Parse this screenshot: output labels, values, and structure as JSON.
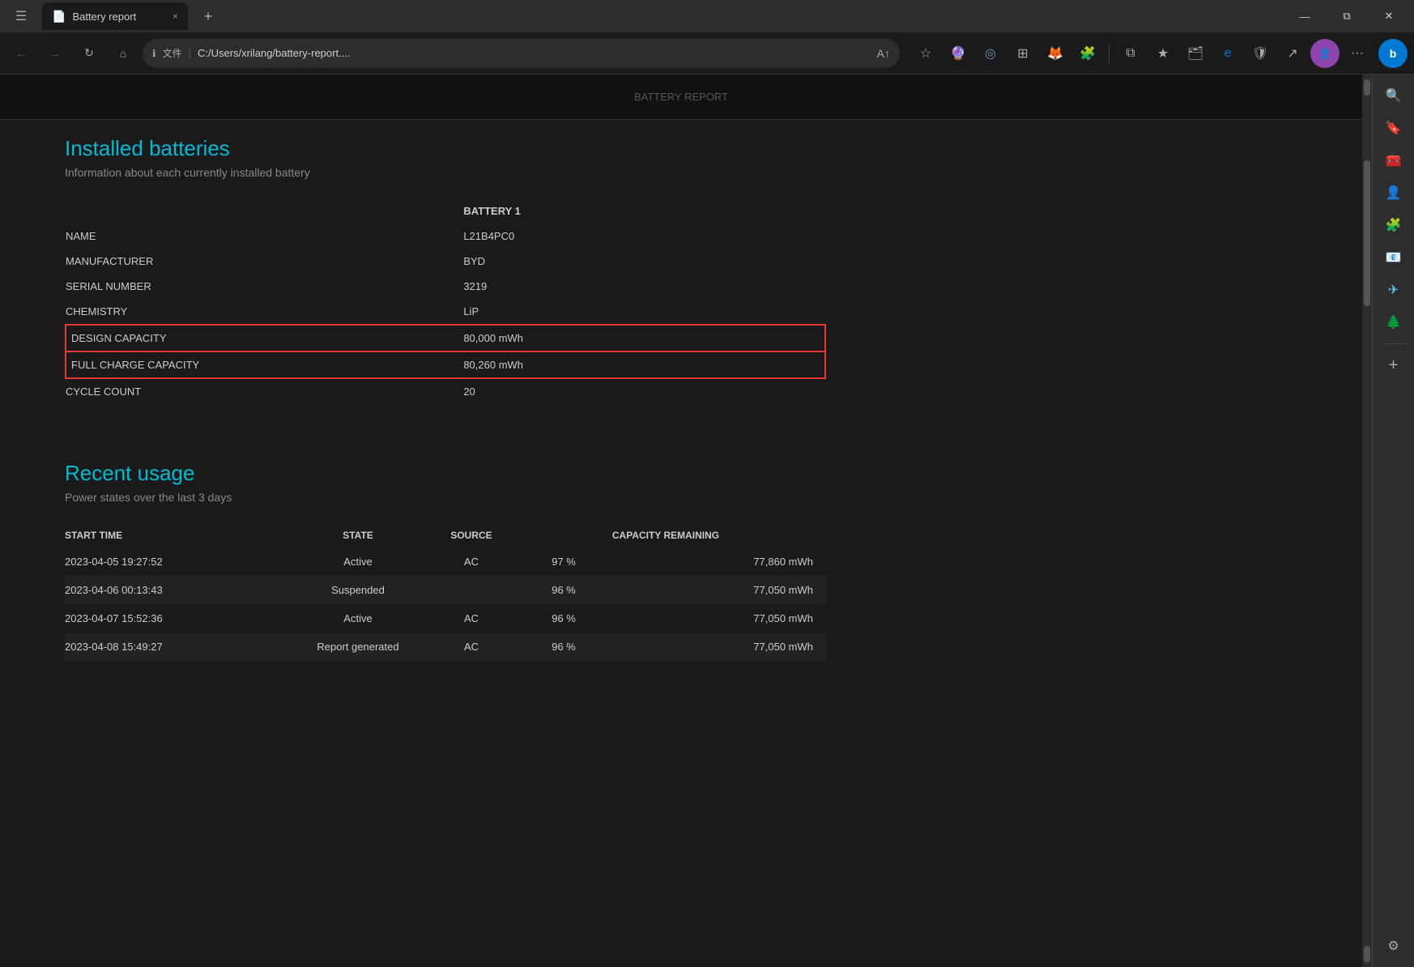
{
  "window": {
    "title": "Battery report",
    "tab_icon": "📄",
    "close_tab": "×",
    "new_tab": "+"
  },
  "browser": {
    "url": "C:/Users/xrilang/battery-report....",
    "url_icon": "ℹ",
    "chinese_label": "文件",
    "back_disabled": true,
    "forward_disabled": true
  },
  "title_bar_controls": {
    "minimize": "—",
    "restore": "⧉",
    "close": "✕"
  },
  "page": {
    "top_banner_text": "BATTERY REPORT",
    "sections": {
      "installed_batteries": {
        "heading": "Installed batteries",
        "description": "Information about each currently installed battery",
        "column_header": "BATTERY 1",
        "rows": [
          {
            "label": "NAME",
            "value": "L21B4PC0"
          },
          {
            "label": "MANUFACTURER",
            "value": "BYD"
          },
          {
            "label": "SERIAL NUMBER",
            "value": "3219"
          },
          {
            "label": "CHEMISTRY",
            "value": "LiP"
          },
          {
            "label": "DESIGN CAPACITY",
            "value": "80,000 mWh",
            "highlighted": true
          },
          {
            "label": "FULL CHARGE CAPACITY",
            "value": "80,260 mWh",
            "highlighted": true
          },
          {
            "label": "CYCLE COUNT",
            "value": "20"
          }
        ]
      },
      "recent_usage": {
        "heading": "Recent usage",
        "description": "Power states over the last 3 days",
        "columns": [
          "START TIME",
          "STATE",
          "SOURCE",
          "CAPACITY REMAINING"
        ],
        "rows": [
          {
            "start_time": "2023-04-05  19:27:52",
            "state": "Active",
            "source": "AC",
            "capacity_pct": "97 %",
            "capacity_mwh": "77,860 mWh"
          },
          {
            "start_time": "2023-04-06  00:13:43",
            "state": "Suspended",
            "source": "",
            "capacity_pct": "96 %",
            "capacity_mwh": "77,050 mWh"
          },
          {
            "start_time": "2023-04-07  15:52:36",
            "state": "Active",
            "source": "AC",
            "capacity_pct": "96 %",
            "capacity_mwh": "77,050 mWh"
          },
          {
            "start_time": "2023-04-08  15:49:27",
            "state": "Report generated",
            "source": "AC",
            "capacity_pct": "96 %",
            "capacity_mwh": "77,050 mWh"
          }
        ]
      }
    }
  },
  "right_sidebar": {
    "icons": [
      {
        "name": "search-icon",
        "symbol": "🔍"
      },
      {
        "name": "bookmark-icon",
        "symbol": "🔖"
      },
      {
        "name": "briefcase-icon",
        "symbol": "🧰"
      },
      {
        "name": "person-icon",
        "symbol": "👤"
      },
      {
        "name": "puzzle-icon",
        "symbol": "🧩"
      },
      {
        "name": "outlook-icon",
        "symbol": "📧"
      },
      {
        "name": "telegram-icon",
        "symbol": "✈"
      },
      {
        "name": "tree-icon",
        "symbol": "🌲"
      },
      {
        "name": "add-icon",
        "symbol": "+"
      },
      {
        "name": "settings-icon",
        "symbol": "⚙"
      }
    ]
  }
}
